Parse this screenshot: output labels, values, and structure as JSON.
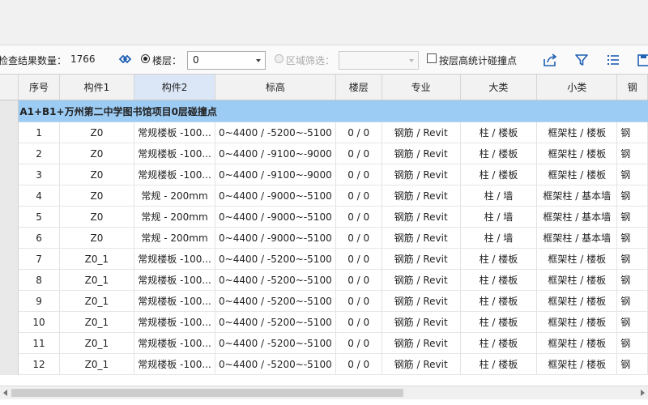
{
  "toolbar": {
    "result_count_label": "检查结果数量：",
    "result_count_value": "1766",
    "floor_label": "楼层：",
    "floor_value": "0",
    "region_label": "区域筛选：",
    "region_value": "",
    "checkbox_label": "按层高统计碰撞点",
    "icons": [
      "expand-all-icon",
      "export-icon",
      "filter-icon",
      "list-view-icon",
      "save-icon"
    ]
  },
  "table": {
    "columns": [
      "序号",
      "构件1",
      "构件2",
      "标高",
      "楼层",
      "专业",
      "大类",
      "小类",
      "钢"
    ],
    "group_title": "A1+B1+万州第二中学图书馆项目0层碰撞点",
    "rows": [
      {
        "no": "1",
        "c1": "Z0",
        "c2": "常规楼板 -100...",
        "elev": "0~4400 / -5200~-5100",
        "floor": "0 / 0",
        "major": "钢筋 / Revit",
        "big": "柱 / 楼板",
        "small": "框架柱 / 楼板",
        "last": "钢"
      },
      {
        "no": "2",
        "c1": "Z0",
        "c2": "常规楼板 -100...",
        "elev": "0~4400 / -9100~-9000",
        "floor": "0 / 0",
        "major": "钢筋 / Revit",
        "big": "柱 / 楼板",
        "small": "框架柱 / 楼板",
        "last": "钢"
      },
      {
        "no": "3",
        "c1": "Z0",
        "c2": "常规楼板 -100...",
        "elev": "0~4400 / -9100~-9000",
        "floor": "0 / 0",
        "major": "钢筋 / Revit",
        "big": "柱 / 楼板",
        "small": "框架柱 / 楼板",
        "last": "钢"
      },
      {
        "no": "4",
        "c1": "Z0",
        "c2": "常规 - 200mm",
        "elev": "0~4400 / -9000~-5100",
        "floor": "0 / 0",
        "major": "钢筋 / Revit",
        "big": "柱 / 墙",
        "small": "框架柱 / 基本墙",
        "last": "钢"
      },
      {
        "no": "5",
        "c1": "Z0",
        "c2": "常规 - 200mm",
        "elev": "0~4400 / -9000~-5100",
        "floor": "0 / 0",
        "major": "钢筋 / Revit",
        "big": "柱 / 墙",
        "small": "框架柱 / 基本墙",
        "last": "钢"
      },
      {
        "no": "6",
        "c1": "Z0",
        "c2": "常规 - 200mm",
        "elev": "0~4400 / -9000~-5100",
        "floor": "0 / 0",
        "major": "钢筋 / Revit",
        "big": "柱 / 墙",
        "small": "框架柱 / 基本墙",
        "last": "钢"
      },
      {
        "no": "7",
        "c1": "Z0_1",
        "c2": "常规楼板 -100...",
        "elev": "0~4400 / -5200~-5100",
        "floor": "0 / 0",
        "major": "钢筋 / Revit",
        "big": "柱 / 楼板",
        "small": "框架柱 / 楼板",
        "last": "钢"
      },
      {
        "no": "8",
        "c1": "Z0_1",
        "c2": "常规楼板 -100...",
        "elev": "0~4400 / -5200~-5100",
        "floor": "0 / 0",
        "major": "钢筋 / Revit",
        "big": "柱 / 楼板",
        "small": "框架柱 / 楼板",
        "last": "钢"
      },
      {
        "no": "9",
        "c1": "Z0_1",
        "c2": "常规楼板 -100...",
        "elev": "0~4400 / -5200~-5100",
        "floor": "0 / 0",
        "major": "钢筋 / Revit",
        "big": "柱 / 楼板",
        "small": "框架柱 / 楼板",
        "last": "钢"
      },
      {
        "no": "10",
        "c1": "Z0_1",
        "c2": "常规楼板 -100...",
        "elev": "0~4400 / -5200~-5100",
        "floor": "0 / 0",
        "major": "钢筋 / Revit",
        "big": "柱 / 楼板",
        "small": "框架柱 / 楼板",
        "last": "钢"
      },
      {
        "no": "11",
        "c1": "Z0_1",
        "c2": "常规楼板 -100...",
        "elev": "0~4400 / -5200~-5100",
        "floor": "0 / 0",
        "major": "钢筋 / Revit",
        "big": "柱 / 楼板",
        "small": "框架柱 / 楼板",
        "last": "钢"
      },
      {
        "no": "12",
        "c1": "Z0_1",
        "c2": "常规楼板 -100...",
        "elev": "0~4400 / -5200~-5100",
        "floor": "0 / 0",
        "major": "钢筋 / Revit",
        "big": "柱 / 楼板",
        "small": "框架柱 / 楼板",
        "last": "钢"
      }
    ]
  },
  "colors": {
    "group_row": "#9ccbf3",
    "selected_header": "#dbe7f6",
    "icon_blue": "#1f5fb4"
  }
}
